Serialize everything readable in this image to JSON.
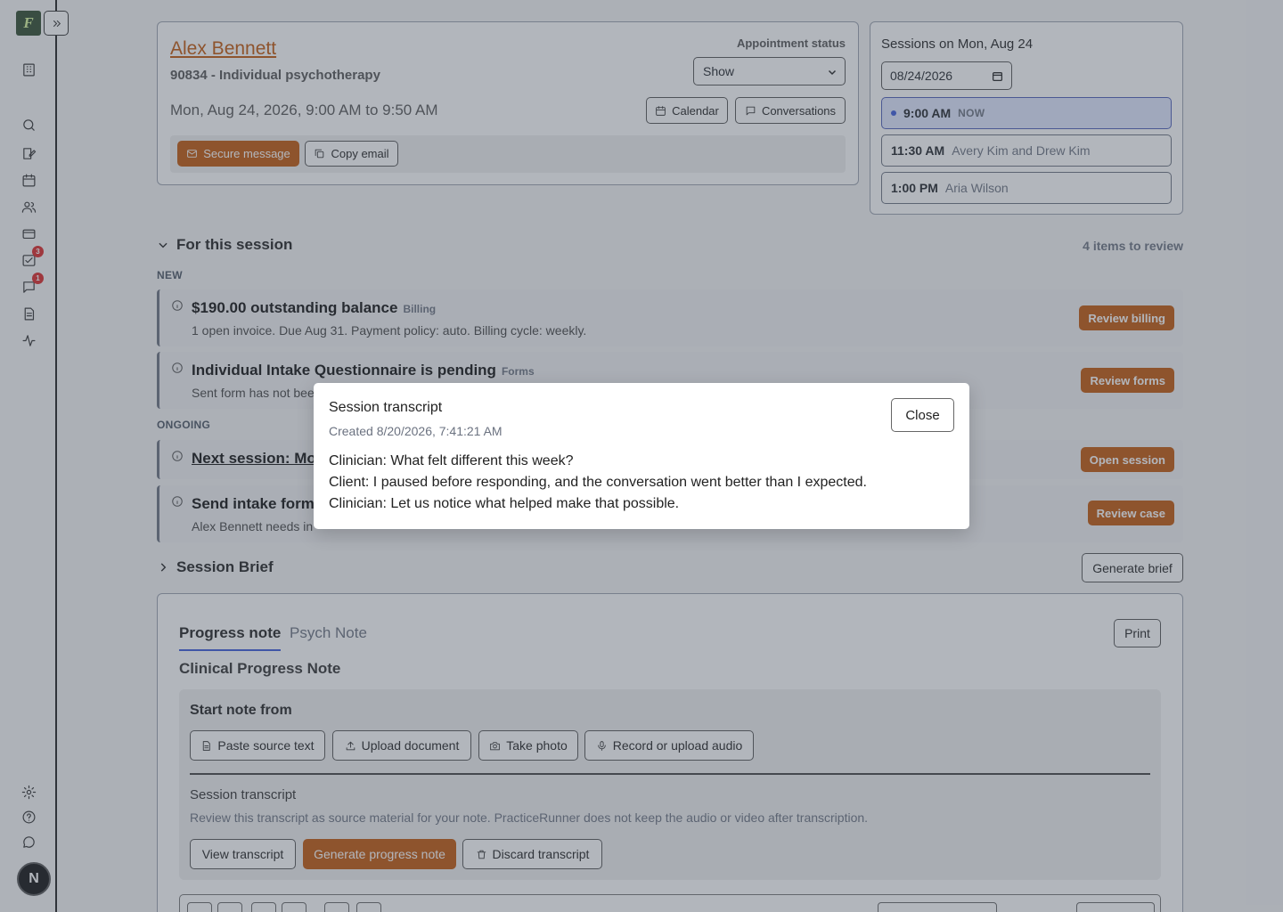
{
  "sidebar": {
    "logo_letter": "F",
    "badges": {
      "inbox": "3",
      "messages": "1"
    },
    "avatar_initial": "N"
  },
  "appointment": {
    "client_name": "Alex Bennett",
    "service": "90834 - Individual psychotherapy",
    "datetime": "Mon, Aug 24, 2026, 9:00 AM to 9:50 AM",
    "status_label": "Appointment status",
    "status_value": "Show",
    "status_options": [
      "Show"
    ],
    "calendar_label": "Calendar",
    "conversations_label": "Conversations",
    "secure_message_label": "Secure message",
    "copy_email_label": "Copy email"
  },
  "sessions": {
    "title": "Sessions on Mon, Aug 24",
    "date_value": "08/24/2026",
    "slots": [
      {
        "time": "9:00 AM",
        "detail": "NOW"
      },
      {
        "time": "11:30 AM",
        "detail": "Avery Kim and Drew Kim"
      },
      {
        "time": "1:00 PM",
        "detail": "Aria Wilson"
      }
    ]
  },
  "review": {
    "heading": "For this session",
    "count": "4 items to review",
    "new_label": "NEW",
    "ongoing_label": "ONGOING",
    "items": [
      {
        "title": "$190.00 outstanding balance",
        "tag": "Billing",
        "desc": "1 open invoice. Due Aug 31. Payment policy: auto. Billing cycle: weekly.",
        "action": "Review billing"
      },
      {
        "title": "Individual Intake Questionnaire is pending",
        "tag": "Forms",
        "desc": "Sent form has not bee",
        "action": "Review forms"
      },
      {
        "title": "Next session: Mor",
        "tag": "",
        "desc": "",
        "action": "Open session"
      },
      {
        "title": "Send intake forms",
        "tag": "",
        "desc": "Alex Bennett needs in",
        "action": "Review case"
      }
    ]
  },
  "brief": {
    "heading": "Session Brief",
    "generate_label": "Generate brief"
  },
  "notes": {
    "tabs": [
      "Progress note",
      "Psych Note"
    ],
    "print_label": "Print",
    "title": "Clinical Progress Note",
    "start_from": "Start note from",
    "sources": [
      "Paste source text",
      "Upload document",
      "Take photo",
      "Record or upload audio"
    ],
    "transcript_heading": "Session transcript",
    "transcript_desc": "Review this transcript as source material for your note. PracticeRunner does not keep the audio or video after transcription.",
    "view_transcript": "View transcript",
    "generate_note": "Generate progress note",
    "discard_transcript": "Discard transcript"
  },
  "modal": {
    "title": "Session transcript",
    "created": "Created 8/20/2026, 7:41:21 AM",
    "close_label": "Close",
    "lines": [
      "Clinician: What felt different this week?",
      "Client: I paused before responding, and the conversation went better than I expected.",
      "Clinician: Let us notice what helped make that possible."
    ]
  }
}
